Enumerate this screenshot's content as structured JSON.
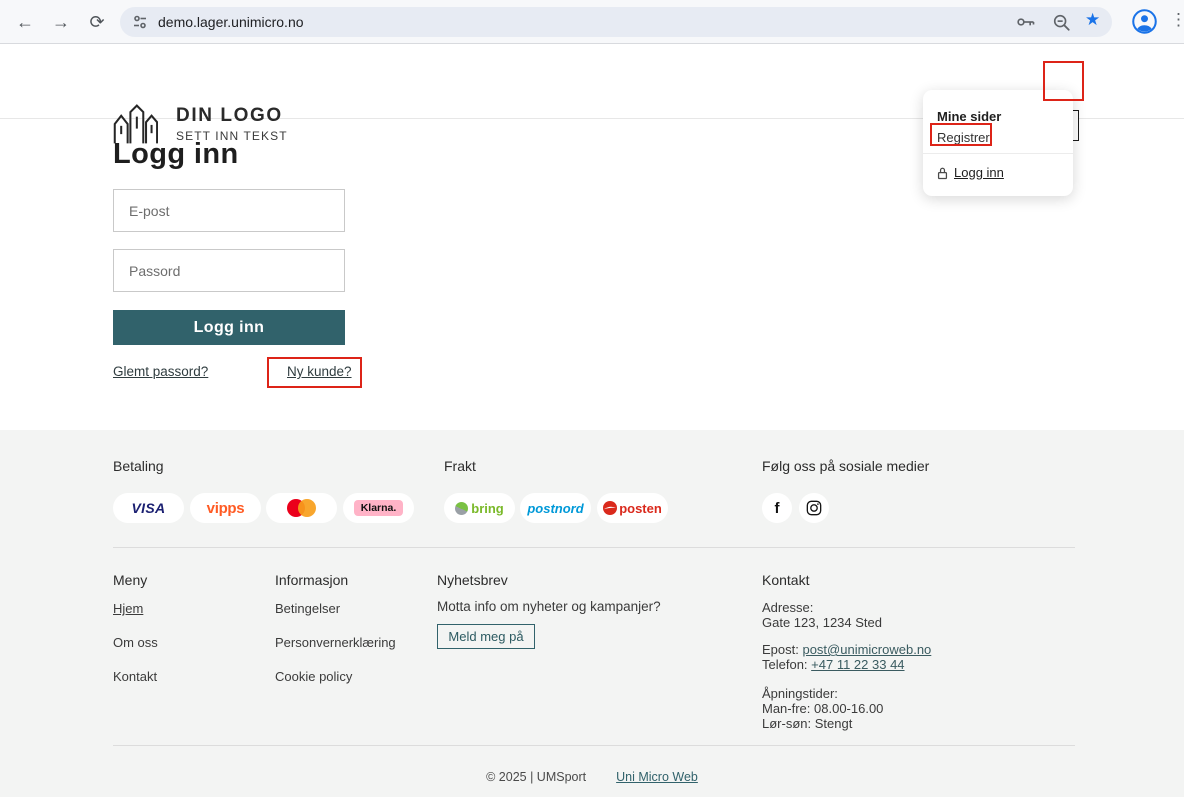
{
  "browser": {
    "url": "demo.lager.unimicro.no"
  },
  "header": {
    "logo_title": "DIN LOGO",
    "logo_subtitle": "SETT INN TEKST"
  },
  "account_menu": {
    "title": "Mine sider",
    "register_label": "Registrer",
    "login_label": "Logg inn"
  },
  "login": {
    "title": "Logg inn",
    "email_placeholder": "E-post",
    "password_placeholder": "Passord",
    "submit_label": "Logg inn",
    "forgot_password_label": "Glemt passord?",
    "new_customer_label": "Ny kunde?"
  },
  "footer": {
    "payment": {
      "title": "Betaling",
      "visa": "VISA",
      "vipps": "vipps",
      "klarna": "Klarna."
    },
    "shipping": {
      "title": "Frakt",
      "bring": "bring",
      "postnord": "postnord",
      "posten": "posten"
    },
    "social": {
      "title": "Følg oss på sosiale medier",
      "facebook": "f"
    },
    "menu": {
      "title": "Meny",
      "items": [
        "Hjem",
        "Om oss",
        "Kontakt"
      ]
    },
    "information": {
      "title": "Informasjon",
      "items": [
        "Betingelser",
        "Personvernerklæring",
        "Cookie policy"
      ]
    },
    "newsletter": {
      "title": "Nyhetsbrev",
      "text": "Motta info om nyheter og kampanjer?",
      "button_label": "Meld meg på"
    },
    "contact": {
      "title": "Kontakt",
      "address_label": "Adresse:",
      "address": "Gate 123, 1234 Sted",
      "email_label": "Epost: ",
      "email": "post@unimicroweb.no",
      "phone_label": "Telefon: ",
      "phone": "+47 11 22 33 44",
      "hours_label": "Åpningstider:",
      "hours_weekdays": "Man-fre: 08.00-16.00",
      "hours_weekend": "Lør-søn: Stengt"
    },
    "copyright": "© 2025 | UMSport",
    "credit": "Uni Micro Web"
  },
  "colors": {
    "accent_teal": "#31626b",
    "annotation_red": "#dd2418",
    "footer_bg": "#f3f4f3"
  }
}
